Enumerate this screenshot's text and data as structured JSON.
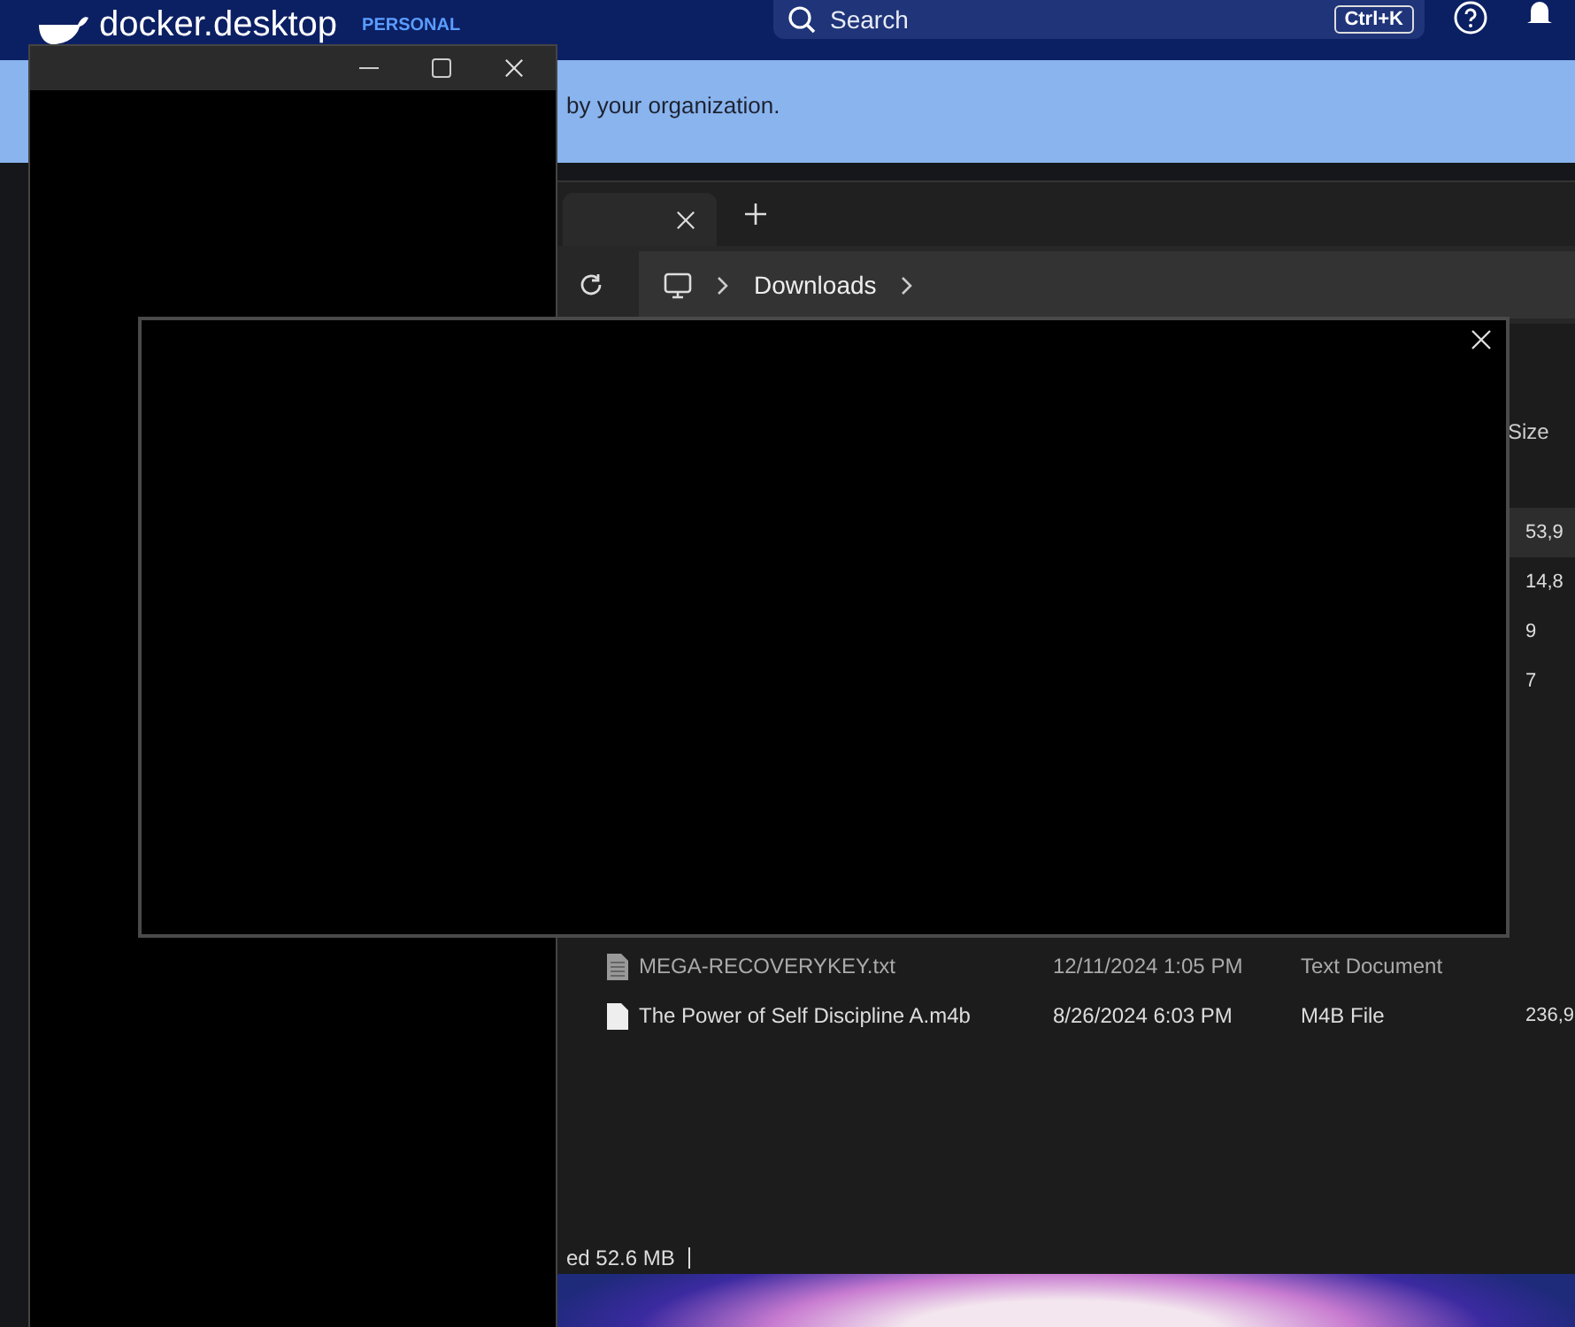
{
  "docker": {
    "logo": "docker.desktop",
    "plan": "PERSONAL",
    "search": {
      "placeholder": "Search",
      "shortcut": "Ctrl+K"
    },
    "banner": "by your organization."
  },
  "explorer": {
    "address": [
      "Downloads"
    ],
    "columns": [
      {
        "label": "Size"
      }
    ],
    "size_rows": [
      {
        "size": "53,9",
        "selected": true
      },
      {
        "size": "14,8",
        "selected": false
      },
      {
        "size": "9",
        "selected": false
      },
      {
        "size": "7",
        "selected": false
      }
    ],
    "files": [
      {
        "kind": "text",
        "name": "MEGA-RECOVERYKEY.txt",
        "date": "12/11/2024 1:05 PM",
        "type": "Text Document"
      },
      {
        "kind": "audio",
        "name": "The Power of Self Discipline A.m4b",
        "date": "8/26/2024 6:03 PM",
        "type": "M4B File",
        "size": "236,9"
      }
    ],
    "status": "ed  52.6 MB"
  }
}
